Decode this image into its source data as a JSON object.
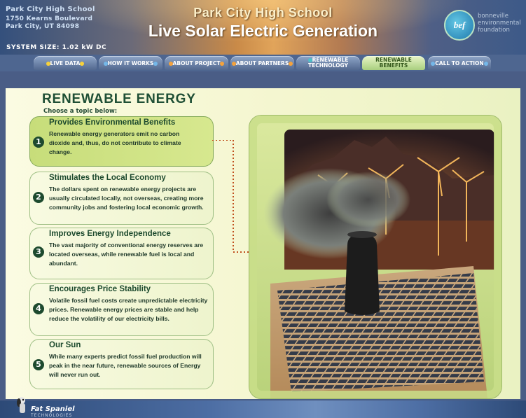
{
  "header": {
    "school_name": "Park City High School",
    "street": "1750 Kearns Boulevard",
    "city": "Park City, UT 84098",
    "title_line1": "Park City High School",
    "title_line2": "Live Solar Electric Generation",
    "system_size": "SYSTEM SIZE: 1.02 kW DC",
    "logo_mark": "bef",
    "logo_text": "bonneville environmental foundation"
  },
  "nav": {
    "items": [
      {
        "label": "LIVE DATA"
      },
      {
        "label": "HOW IT WORKS"
      },
      {
        "label": "ABOUT PROJECT"
      },
      {
        "label": "ABOUT PARTNERS"
      },
      {
        "label": "RENEWABLE TECHNOLOGY",
        "line1": "RENEWABLE",
        "line2": "TECHNOLOGY"
      },
      {
        "label": "RENEWABLE BENEFITS",
        "line1": "RENEWABLE",
        "line2": "BENEFITS"
      },
      {
        "label": "CALL TO ACTION"
      }
    ],
    "active_index": 5
  },
  "main": {
    "title": "RENEWABLE ENERGY",
    "subtitle": "Choose a topic below:",
    "topics": [
      {
        "num": "1",
        "title": "Provides Environmental Benefits",
        "body": "Renewable energy generators emit no carbon dioxide and, thus, do not contribute to climate change."
      },
      {
        "num": "2",
        "title": "Stimulates the Local Economy",
        "body": "The dollars spent on renewable energy projects are usually circulated locally, not overseas, creating more community jobs and fostering local economic growth."
      },
      {
        "num": "3",
        "title": "Improves Energy Independence",
        "body": "The vast majority of conventional energy reserves are located overseas, while renewable fuel is local and abundant."
      },
      {
        "num": "4",
        "title": "Encourages Price Stability",
        "body": "Volatile fossil fuel costs create unpredictable electricity prices.  Renewable energy prices are stable and help reduce the volatility of our electricity bills."
      },
      {
        "num": "5",
        "title": "Our Sun",
        "body": "While many experts predict fossil fuel production will peak in the near future, renewable sources of Energy will never run out."
      }
    ],
    "active_topic": 0
  },
  "footer": {
    "brand": "Fat Spaniel",
    "brand_sub": "TECHNOLOGIES"
  },
  "colors": {
    "accent_green": "#1d4a2e",
    "nav_blue": "#52688f",
    "active_tab": "#a9cf7f"
  }
}
